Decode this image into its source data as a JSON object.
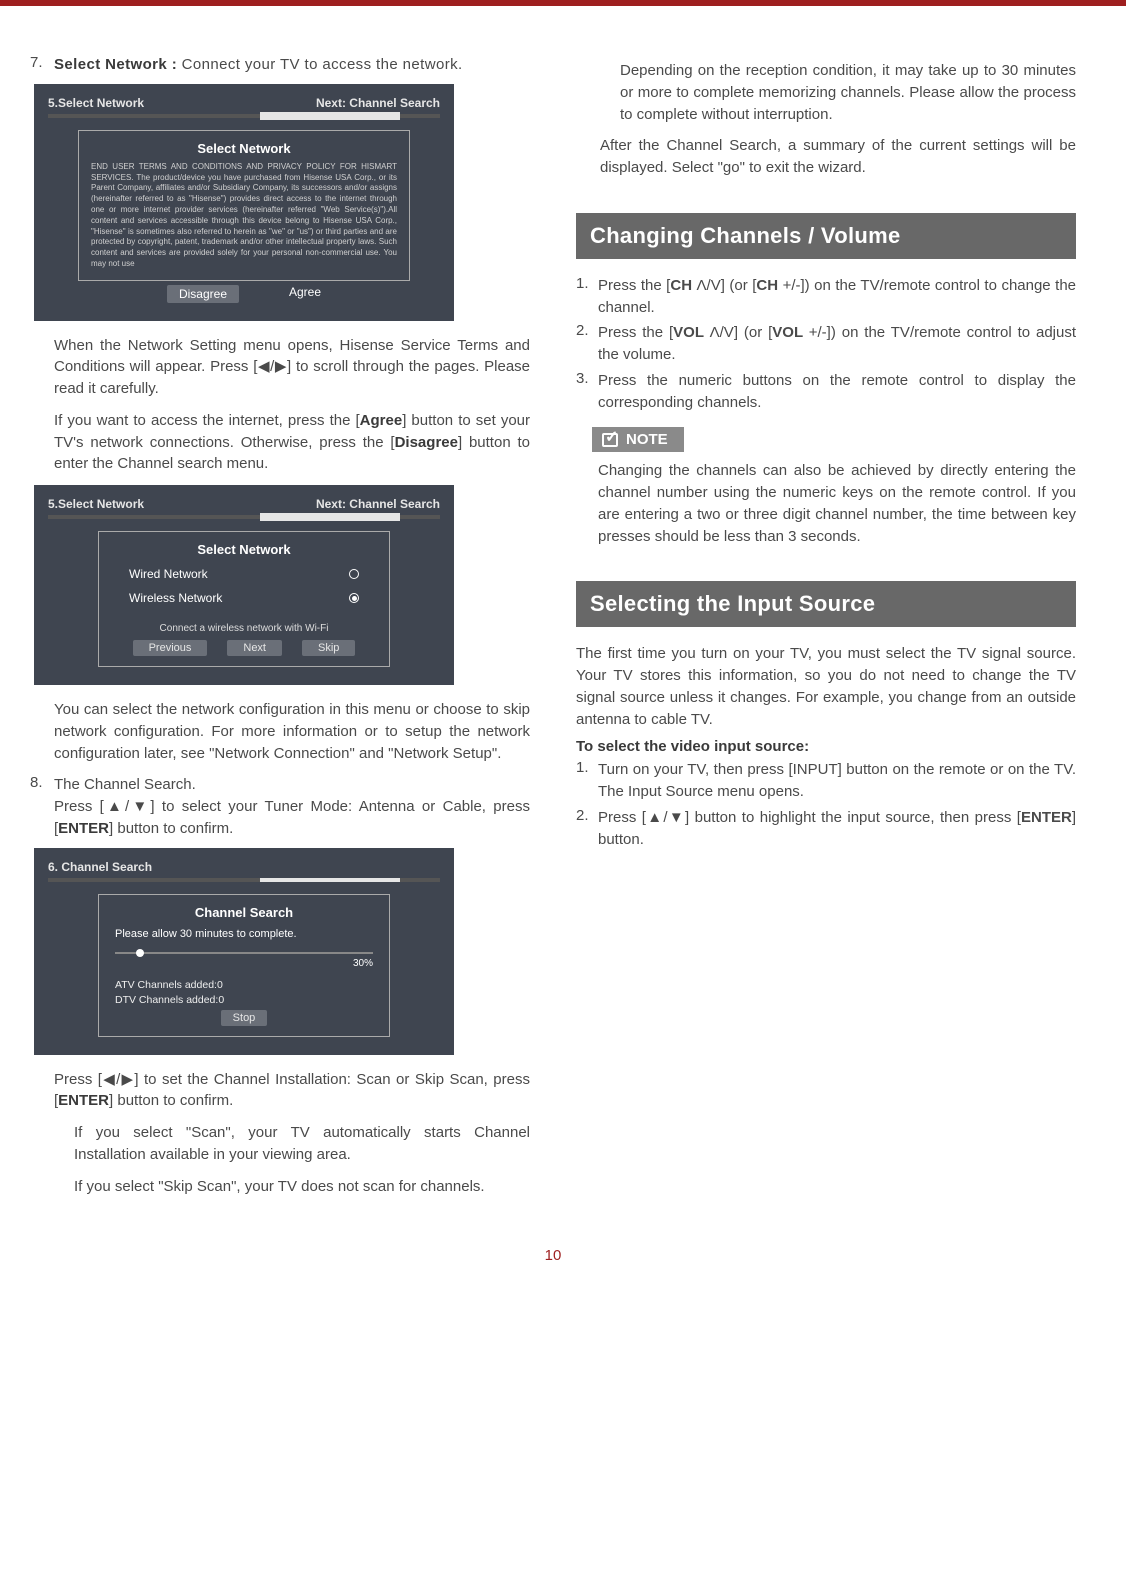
{
  "page_number": "10",
  "left": {
    "step7": {
      "num": "7.",
      "title_html": "Select Network : ",
      "title_tail": "Connect your TV to access the network."
    },
    "box1": {
      "hdr_left": "5.Select Network",
      "hdr_right": "Next: Channel Search",
      "panel_title": "Select Network",
      "terms": "END USER TERMS AND CONDITIONS AND PRIVACY POLICY FOR HISMART SERVICES. The product/device you have purchased from Hisense USA Corp., or its Parent Company, affiliates and/or Subsidiary Company, its successors and/or assigns (hereinafter referred to as \"Hisense\") provides direct access to the internet through one or more internet provider services (hereinafter referred \"Web Service(s)\").All content and services accessible through this device belong to Hisense USA Corp., \"Hisense\" is sometimes also referred to herein as \"we\" or \"us\") or third parties and are protected by copyright, patent, trademark and/or other intellectual property laws. Such content and services are provided solely for your personal non-commercial use. You may not use",
      "btn_disagree": "Disagree",
      "btn_agree": "Agree"
    },
    "p_after_box1": "When the Network Setting menu opens, Hisense Service Terms and Conditions will appear. Press [◀/▶] to scroll through the pages. Please read it carefully.",
    "p_agree": "If you want to access the internet, press the [Agree] button to set your TV's network connections. Otherwise, press the [Disagree] button to enter the Channel search menu.",
    "box2": {
      "hdr_left": "5.Select Network",
      "hdr_right": "Next: Channel Search",
      "panel_title": "Select Network",
      "opt_wired": "Wired Network",
      "opt_wireless": "Wireless Network",
      "hint": "Connect a wireless network with Wi-Fi",
      "btn_prev": "Previous",
      "btn_next": "Next",
      "btn_skip": "Skip"
    },
    "p_after_box2": "You can select the network configuration in this menu or choose to skip network configuration. For more information or to setup the network configuration later, see \"Network Connection\" and \"Network Setup\".",
    "step8": {
      "num": "8.",
      "line1": "The Channel Search.",
      "line2_a": "Press [▲/▼] to select your Tuner Mode: Antenna or Cable, press [",
      "line2_b": "ENTER",
      "line2_c": "] button to confirm."
    },
    "box3": {
      "hdr_left": "6. Channel Search",
      "panel_title": "Channel Search",
      "sub": "Please allow 30 minutes to complete.",
      "percent": "30%",
      "atv": "ATV Channels added:0",
      "dtv": "DTV Channels added:0",
      "btn_stop": "Stop"
    },
    "p_after_box3_a": "Press [◀/▶] to set the Channel Installation: Scan or Skip Scan, press [",
    "p_after_box3_b": "ENTER",
    "p_after_box3_c": "] button to confirm.",
    "scan_para": "If you select \"Scan\", your TV automatically starts Channel Installation available in your viewing area.",
    "skipscan_para": "If you select \"Skip Scan\", your TV does not scan for channels."
  },
  "right": {
    "top_para1": "Depending on the reception condition, it may take up to 30 minutes or more to complete memorizing channels. Please allow the process to complete without interruption.",
    "top_para2": "After the Channel Search, a summary of the current settings will be displayed.  Select \"go\" to exit the wizard.",
    "h2_a": "Changing Channels / Volume",
    "cc_steps": [
      {
        "n": "1.",
        "t_a": "Press the [",
        "t_b": "CH ",
        "t_c": "Λ/V] (or [",
        "t_d": "CH ",
        "t_e": "+/-]) on the TV/remote control to change the channel."
      },
      {
        "n": "2.",
        "t_a": "Press the [",
        "t_b": "VOL ",
        "t_c": "Λ/V] (or [",
        "t_d": "VOL ",
        "t_e": "+/-]) on the TV/remote control to adjust the volume."
      },
      {
        "n": "3.",
        "t": "Press the numeric buttons on the remote control to display the corresponding channels."
      }
    ],
    "note_label": "NOTE",
    "note_body": "Changing the channels can also be achieved by directly entering the channel number using the numeric keys on the remote control. If you are entering a two or three digit channel number, the time between key presses should be less than 3 seconds.",
    "h2_b": "Selecting the Input Source",
    "sel_para": "The first time you turn on your TV, you must select the TV signal source. Your TV stores this information, so you do not need to change the TV signal source unless it changes. For example, you change from an outside antenna to cable TV.",
    "sel_bold": "To select the video input source:",
    "sel_steps": [
      {
        "n": "1.",
        "t": "Turn on your TV, then press [INPUT] button on the remote or on the TV. The Input Source menu opens."
      },
      {
        "n": "2.",
        "t_a": "Press [▲/▼] button to highlight the input source, then press [",
        "t_b": "ENTER",
        "t_c": "] button."
      }
    ]
  }
}
